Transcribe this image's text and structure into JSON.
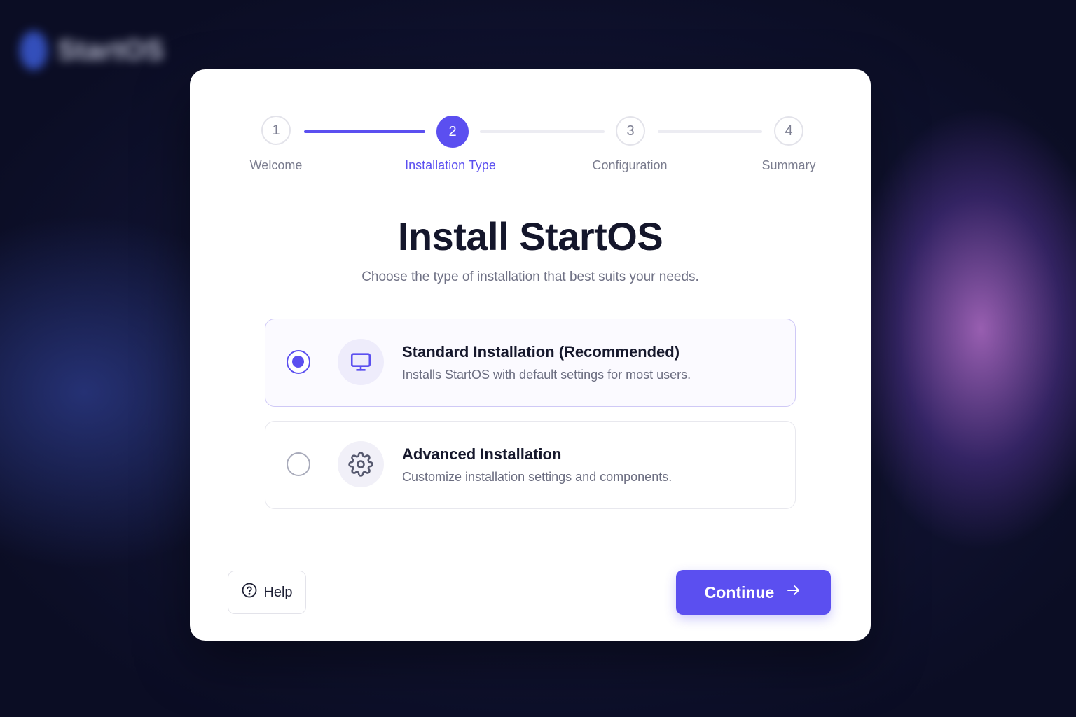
{
  "background": {
    "logo_text": "StartOS"
  },
  "stepper": {
    "steps": [
      {
        "number": "1",
        "label": "Welcome"
      },
      {
        "number": "2",
        "label": "Installation Type"
      },
      {
        "number": "3",
        "label": "Configuration"
      },
      {
        "number": "4",
        "label": "Summary"
      }
    ],
    "current_step": 2
  },
  "main": {
    "title": "Install StartOS",
    "subtitle": "Choose the type of installation that best suits your needs."
  },
  "options": [
    {
      "title": "Standard Installation (Recommended)",
      "description": "Installs StartOS with default settings for most users.",
      "icon": "monitor-icon",
      "selected": true
    },
    {
      "title": "Advanced Installation",
      "description": "Customize installation settings and components.",
      "icon": "gear-icon",
      "selected": false
    }
  ],
  "footer": {
    "help_label": "Help",
    "continue_label": "Continue"
  },
  "colors": {
    "accent": "#5b4ff0",
    "text_primary": "#14162b",
    "text_muted": "#6f7185"
  }
}
